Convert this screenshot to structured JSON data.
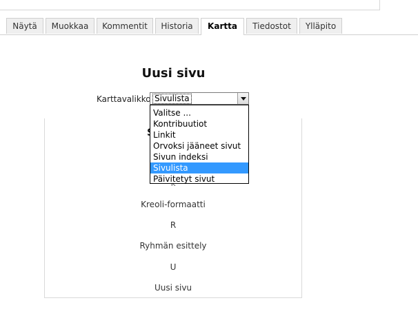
{
  "tabs": [
    {
      "label": "Näytä"
    },
    {
      "label": "Muokkaa"
    },
    {
      "label": "Kommentit"
    },
    {
      "label": "Historia"
    },
    {
      "label": "Kartta",
      "active": true
    },
    {
      "label": "Tiedostot"
    },
    {
      "label": "Ylläpito"
    }
  ],
  "page": {
    "title": "Uusi sivu"
  },
  "map_menu": {
    "label": "Karttavalikko:",
    "selected": "Sivulista",
    "options": [
      "Valitse ...",
      "Kontribuutiot",
      "Linkit",
      "Orvoksi jääneet sivut",
      "Sivun indeksi",
      "Sivulista",
      "Päivitetyt sivut"
    ],
    "highlighted_index": 5
  },
  "content": {
    "partial_letter": "S",
    "partial_letter_2": "K",
    "items": [
      "Kreoli-formaatti",
      "R",
      "Ryhmän esittely",
      "U",
      "Uusi sivu"
    ]
  }
}
